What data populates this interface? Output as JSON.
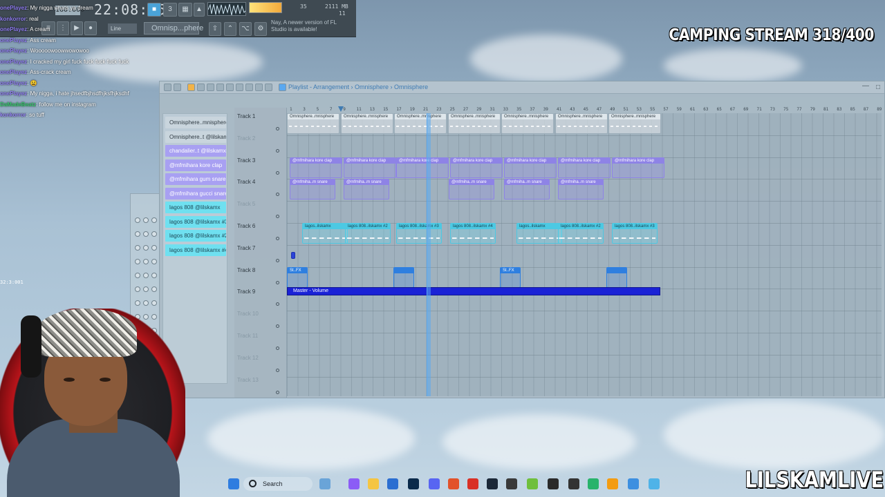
{
  "toolbar": {
    "clock": "22:08:06",
    "bpm": "160.000",
    "memory": "2111 MB",
    "cpu_small": "35",
    "voices": "11",
    "pattern_name": "Omnisp...phere",
    "line_mode": "Line",
    "notice": "Nay, A newer version of FL Studio is available!"
  },
  "chat": [
    {
      "user": "onePlayez",
      "text": "My nigga whats ya dream",
      "color": "purple"
    },
    {
      "user": "konkorror",
      "text": "real",
      "color": "purple"
    },
    {
      "user": "onePlayez",
      "text": "A cream",
      "color": "purple"
    },
    {
      "user": "onePlayez",
      "text": "Ass cream",
      "color": "purple"
    },
    {
      "user": "onePlayez",
      "text": "Wooooowoowwowowoo",
      "color": "purple"
    },
    {
      "user": "onePlayez",
      "text": "I cracked my girl fuck fuck fuck fuck fuck",
      "color": "purple"
    },
    {
      "user": "onePlayez",
      "text": "Ass-crack cream",
      "color": "purple"
    },
    {
      "user": "onePlayez",
      "text": "😫",
      "color": "purple"
    },
    {
      "user": "onePlayez",
      "text": "My nigga, i hate jhsedfbjhsdfhjksfhjksdhf",
      "color": "purple"
    },
    {
      "user": "DaMadeBeatz",
      "text": "follow me on instagram",
      "color": "green"
    },
    {
      "user": "konkorror",
      "text": "so tuff",
      "color": "purple"
    }
  ],
  "overlay": {
    "stream_title": "CAMPING STREAM 318/400",
    "channel": "LILSKAMLIVE",
    "side_counter": "32:3:001"
  },
  "playlist": {
    "title": "Playlist - Arrangement › Omnisphere › Omnisphere",
    "picker": [
      {
        "label": "Omnisphere..mnisphere",
        "kind": "synth"
      },
      {
        "label": "Omnisphere..t @lilskamx",
        "kind": "synth"
      },
      {
        "label": "chandalier..t @lilskamx",
        "kind": "drum"
      },
      {
        "label": "@mfmihara kore clap",
        "kind": "drum"
      },
      {
        "label": "@mfmihara gum snare",
        "kind": "drum"
      },
      {
        "label": "@mfmihara gucci snare",
        "kind": "drum"
      },
      {
        "label": "lagos 808 @lilskamx",
        "kind": "bass"
      },
      {
        "label": "lagos 808 @lilskamx #3",
        "kind": "bass"
      },
      {
        "label": "lagos 808 @lilskamx #2",
        "kind": "bass"
      },
      {
        "label": "lagos 808 @lilskamx #4",
        "kind": "bass"
      }
    ],
    "tracks": [
      "Track 1",
      "Track 2",
      "Track 3",
      "Track 4",
      "Track 5",
      "Track 6",
      "Track 7",
      "Track 8",
      "Track 9",
      "Track 10",
      "Track 11",
      "Track 12",
      "Track 13"
    ],
    "ruler": [
      "1",
      "3",
      "5",
      "7",
      "9",
      "11",
      "13",
      "15",
      "17",
      "19",
      "21",
      "23",
      "25",
      "27",
      "29",
      "31",
      "33",
      "35",
      "37",
      "39",
      "41",
      "43",
      "45",
      "47",
      "49",
      "51",
      "53",
      "55",
      "57",
      "59",
      "61",
      "63",
      "65",
      "67",
      "69",
      "71",
      "73",
      "75",
      "77",
      "79",
      "81",
      "83",
      "85",
      "87",
      "89"
    ],
    "clips": {
      "track1": [
        "Omnisphere..mnisphere",
        "Omnisphere..mnisphere",
        "Omnisphere..mnisphere",
        "Omnisphere..mnisphere",
        "Omnisphere..mnisphere",
        "Omnisphere..mnisphere",
        "Omnisphere..mnisphere"
      ],
      "track3": [
        "@mfmihara kore clap",
        "@mfmihara kore clap",
        "@mfmihara kore clap",
        "@mfmihara kore clap",
        "@mfmihara kore clap",
        "@mfmihara kore clap",
        "@mfmihara kore clap"
      ],
      "track4": [
        "@mfmiha..m snare",
        "@mfmiha..m snare",
        "@mfmiha..m snare",
        "@mfmiha..m snare",
        "@mfmiha..m snare"
      ],
      "track6": [
        "lagos..ilskamx",
        "lagos 808..ilskamx #2",
        "lagos 808..ilskamx #3",
        "lagos 808..ilskamx #4",
        "lagos..ilskamx",
        "lagos 808..ilskamx #2",
        "lagos 808..ilskamx #3"
      ],
      "track8": [
        "St..FX",
        "",
        "St..FX",
        ""
      ],
      "master": "Master - Volume"
    }
  },
  "taskbar": {
    "search": "Search"
  }
}
